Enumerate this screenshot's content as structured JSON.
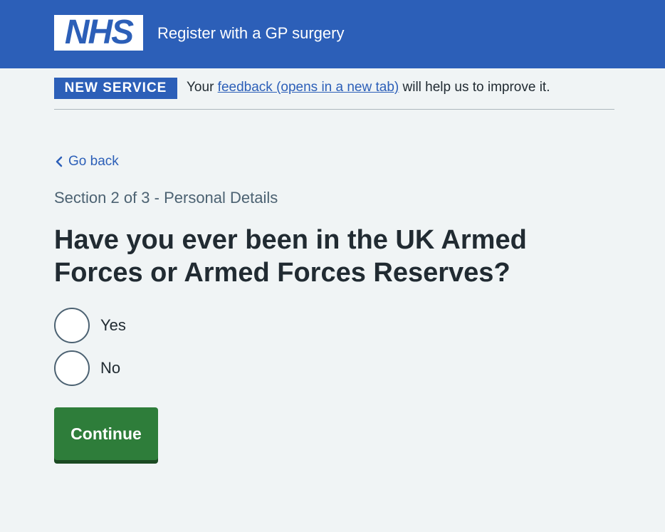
{
  "header": {
    "logo_text": "NHS",
    "service_name": "Register with a GP surgery"
  },
  "phase_banner": {
    "tag": "NEW SERVICE",
    "text_before": "Your ",
    "link_text": "feedback (opens in a new tab)",
    "text_after": " will help us to improve it."
  },
  "back_link": {
    "label": "Go back",
    "icon": "chevron-left-icon"
  },
  "form": {
    "caption": "Section 2 of 3 - Personal Details",
    "question": "Have you ever been in the UK Armed Forces or Armed Forces Reserves?",
    "options": [
      {
        "label": "Yes",
        "selected": false
      },
      {
        "label": "No",
        "selected": false
      }
    ],
    "continue_label": "Continue"
  },
  "colors": {
    "nhs_blue": "#2c5fb8",
    "background": "#f0f4f5",
    "text": "#212b32",
    "secondary_text": "#4c6272",
    "button_green": "#2e7d3a"
  }
}
